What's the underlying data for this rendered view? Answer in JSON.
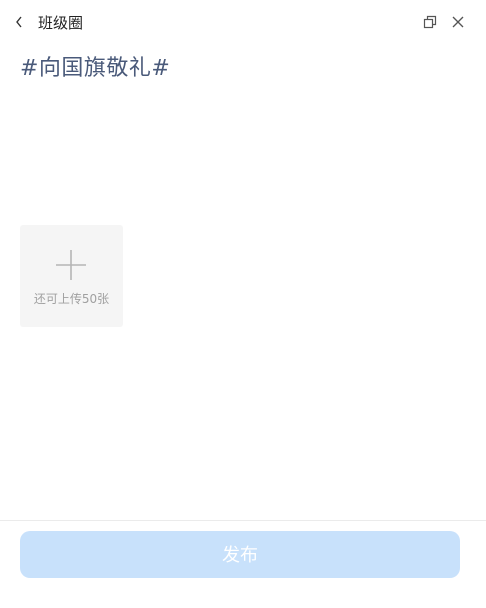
{
  "window": {
    "title": "班级圈"
  },
  "icons": {
    "back": "chevron-left-icon",
    "restore": "restore-window-icon",
    "close": "close-icon",
    "add": "plus-icon"
  },
  "post": {
    "text": "#向国旗敬礼#"
  },
  "upload": {
    "label": "还可上传50张"
  },
  "footer": {
    "publish_label": "发布"
  },
  "colors": {
    "post_text": "#4a5a7a",
    "publish_button_bg": "#c8e1fb",
    "upload_tile_bg": "#f5f5f5"
  }
}
